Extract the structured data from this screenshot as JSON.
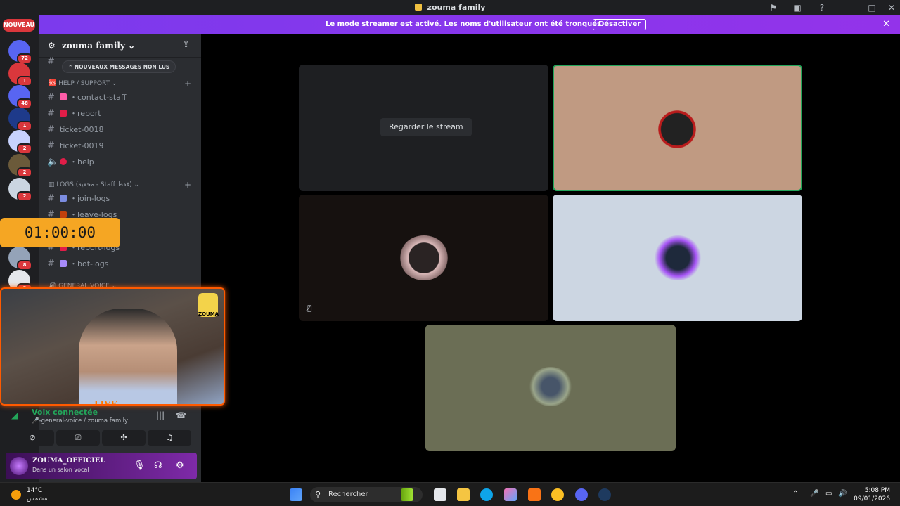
{
  "window": {
    "title": "zouma family"
  },
  "banner": {
    "message": "Le mode streamer est activé. Les noms d'utilisateur ont été tronqués.",
    "button": "Désactiver"
  },
  "servers": {
    "new_label": "NOUVEAU",
    "badges": [
      "72",
      "1",
      "48",
      "1",
      "2",
      "2",
      "2",
      "8",
      "3"
    ]
  },
  "guild": {
    "name": "zouma family",
    "new_messages_pill": "NOUVEAUX MESSAGES NON LUS",
    "categories": [
      {
        "label": "HELP / SUPPORT"
      },
      {
        "label": "LOGS (مخفية - Staff فقط)"
      },
      {
        "label": "GENERAL VOICE"
      }
    ],
    "channels": [
      {
        "name": "・contact-staff",
        "emoji_color": "#ff5ca8"
      },
      {
        "name": "・report",
        "emoji_color": "#e11d48"
      },
      {
        "name": "ticket-0018",
        "emoji_color": ""
      },
      {
        "name": "ticket-0019",
        "emoji_color": ""
      },
      {
        "name": "・help",
        "emoji_color": "#e11d48"
      },
      {
        "name": "・join-logs",
        "emoji_color": "#7b8ce0"
      },
      {
        "name": "・leave-logs",
        "emoji_color": "#c2410c"
      },
      {
        "name": "・report-logs",
        "emoji_color": "#e11d48"
      },
      {
        "name": "・bot-logs",
        "emoji_color": "#a78bfa"
      }
    ]
  },
  "timer": {
    "value": "01:00:00"
  },
  "webcam": {
    "live_label": "LIVE",
    "logo_text": "ZOUMA"
  },
  "voice": {
    "status": "Voix connectée",
    "channel": "-general-voice / zouma family"
  },
  "user": {
    "name": "ZOUMA_OFFICIEL",
    "status": "Dans un salon vocal"
  },
  "stage": {
    "watch_button": "Regarder le stream"
  },
  "taskbar": {
    "temperature": "14°C",
    "weather": "مشمس",
    "search_placeholder": "Rechercher",
    "time": "5:08 PM",
    "date": "09/01/2026"
  },
  "colors": {
    "accent": "#7c3aed",
    "speaking_border": "#23a55a",
    "timer_bg": "#f5a623",
    "webcam_frame": "#ff5a00"
  }
}
